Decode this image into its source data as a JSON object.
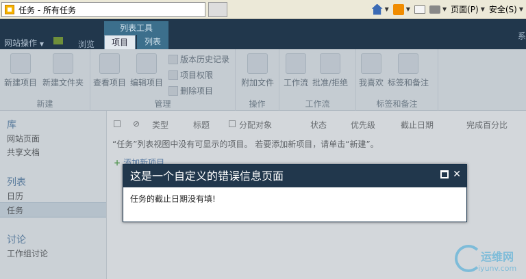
{
  "browser": {
    "tab_title": "任务 - 所有任务",
    "tools": [
      "页面(P)",
      "安全(S)"
    ]
  },
  "header": {
    "site_actions": "网站操作",
    "browse": "浏览",
    "context_group": "列表工具",
    "tabs": [
      "项目",
      "列表"
    ],
    "corner": "系"
  },
  "ribbon": {
    "groups": [
      {
        "label": "新建",
        "buttons": [
          "新建项目",
          "新建文件夹"
        ]
      },
      {
        "label": "管理",
        "buttons": [
          "查看项目",
          "编辑项目"
        ],
        "small": [
          "版本历史记录",
          "项目权限",
          "删除项目"
        ]
      },
      {
        "label": "操作",
        "buttons": [
          "附加文件"
        ]
      },
      {
        "label": "工作流",
        "buttons": [
          "工作流",
          "批准/拒绝"
        ]
      },
      {
        "label": "标签和备注",
        "buttons": [
          "我喜欢",
          "标签和备注"
        ]
      }
    ]
  },
  "leftnav": {
    "sections": [
      {
        "title": "库",
        "items": [
          "网站页面",
          "共享文档"
        ]
      },
      {
        "title": "列表",
        "items": [
          "日历",
          "任务"
        ]
      },
      {
        "title": "讨论",
        "items": [
          "工作组讨论"
        ]
      }
    ]
  },
  "list": {
    "columns": [
      "类型",
      "标题",
      "分配对象",
      "状态",
      "优先级",
      "截止日期",
      "完成百分比"
    ],
    "empty_message": "“任务”列表视图中没有可显示的项目。 若要添加新项目，请单击“新建”。",
    "add_item": "添加新项目"
  },
  "dialog": {
    "title": "这是一个自定义的错误信息页面",
    "message": "任务的截止日期没有填!"
  },
  "watermark": {
    "cn": "运维网",
    "en": "iyunv.com"
  }
}
